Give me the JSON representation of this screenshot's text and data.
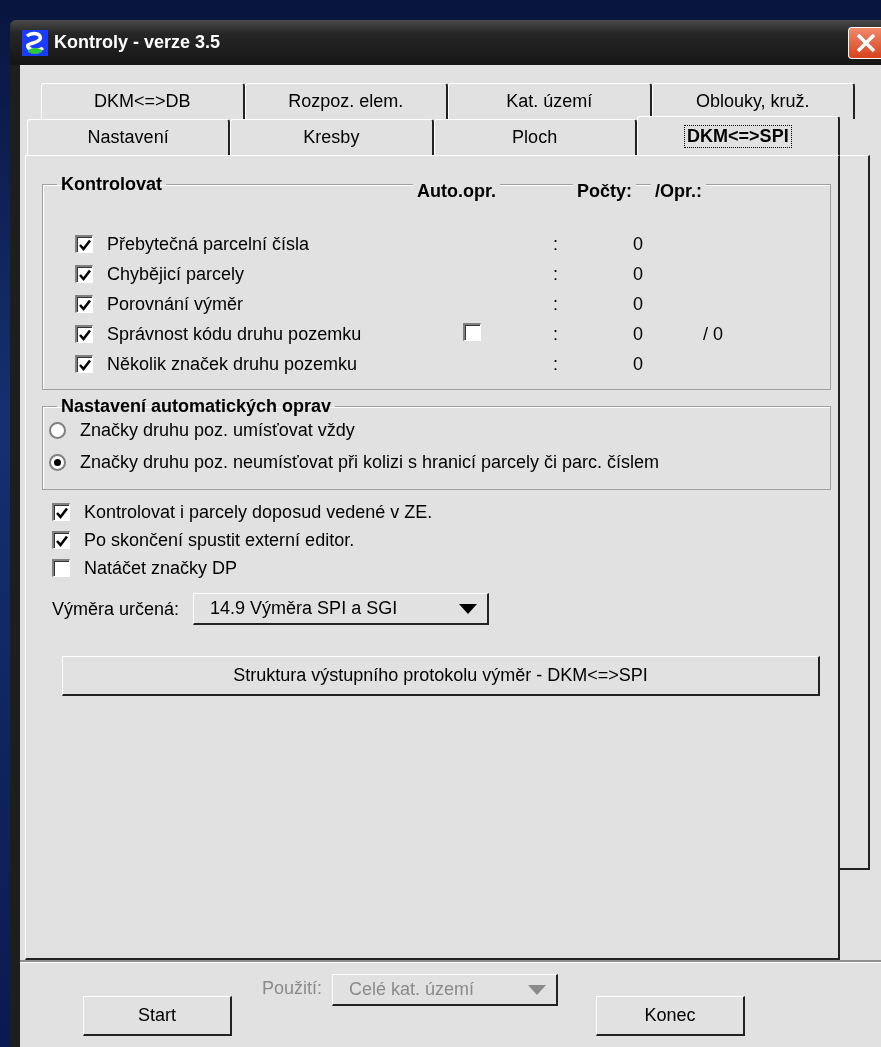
{
  "window": {
    "title": "Kontroly - verze 3.5"
  },
  "tab_rows": [
    {
      "tabs": [
        {
          "label": "DKM<=>DB",
          "selected": false
        },
        {
          "label": "Rozpoz. elem.",
          "selected": false
        },
        {
          "label": "Kat. území",
          "selected": false
        },
        {
          "label": "Oblouky, kruž.",
          "selected": false
        }
      ]
    },
    {
      "tabs": [
        {
          "label": "Nastavení",
          "selected": false
        },
        {
          "label": "Kresby",
          "selected": false
        },
        {
          "label": "Ploch",
          "selected": false
        },
        {
          "label": "DKM<=>SPI",
          "selected": true
        }
      ]
    }
  ],
  "check_group": {
    "title": "Kontrolovat",
    "columns": [
      "Auto.opr.",
      "Počty:",
      "/Opr.:"
    ],
    "rows": [
      {
        "label": "Přebytečná parcelní čísla",
        "checked": true,
        "colon": ":",
        "count": "0"
      },
      {
        "label": "Chybějicí parcely",
        "checked": true,
        "colon": ":",
        "count": "0"
      },
      {
        "label": "Porovnání výměr",
        "checked": true,
        "colon": ":",
        "count": "0"
      },
      {
        "label": "Správnost kódu druhu pozemku",
        "checked": true,
        "auto_fix": {
          "checked": false
        },
        "colon": ":",
        "count": "0",
        "fixed": "/  0"
      },
      {
        "label": "Několik značek druhu pozemku",
        "checked": true,
        "colon": ":",
        "count": "0"
      }
    ]
  },
  "auto_group": {
    "title": "Nastavení automatických oprav",
    "options": [
      {
        "label": "Značky druhu poz. umísťovat vždy",
        "selected": false
      },
      {
        "label": "Značky druhu poz. neumísťovat při kolizi s hranicí parcely či parc. číslem",
        "selected": true
      }
    ]
  },
  "options": [
    {
      "label": "Kontrolovat i parcely doposud vedené v ZE.",
      "checked": true
    },
    {
      "label": "Po skončení spustit externí editor.",
      "checked": true
    },
    {
      "label": "Natáčet značky DP",
      "checked": false
    }
  ],
  "area": {
    "label": "Výměra určená:",
    "value": "14.9 Výměra SPI a SGI"
  },
  "protocol_button": {
    "label": "Struktura výstupního protokolu výměr - DKM<=>SPI"
  },
  "footer": {
    "start": {
      "label": "Start"
    },
    "usage": {
      "label": "Použití:",
      "value": "Celé kat. území",
      "disabled": true
    },
    "end": {
      "label": "Konec"
    }
  }
}
